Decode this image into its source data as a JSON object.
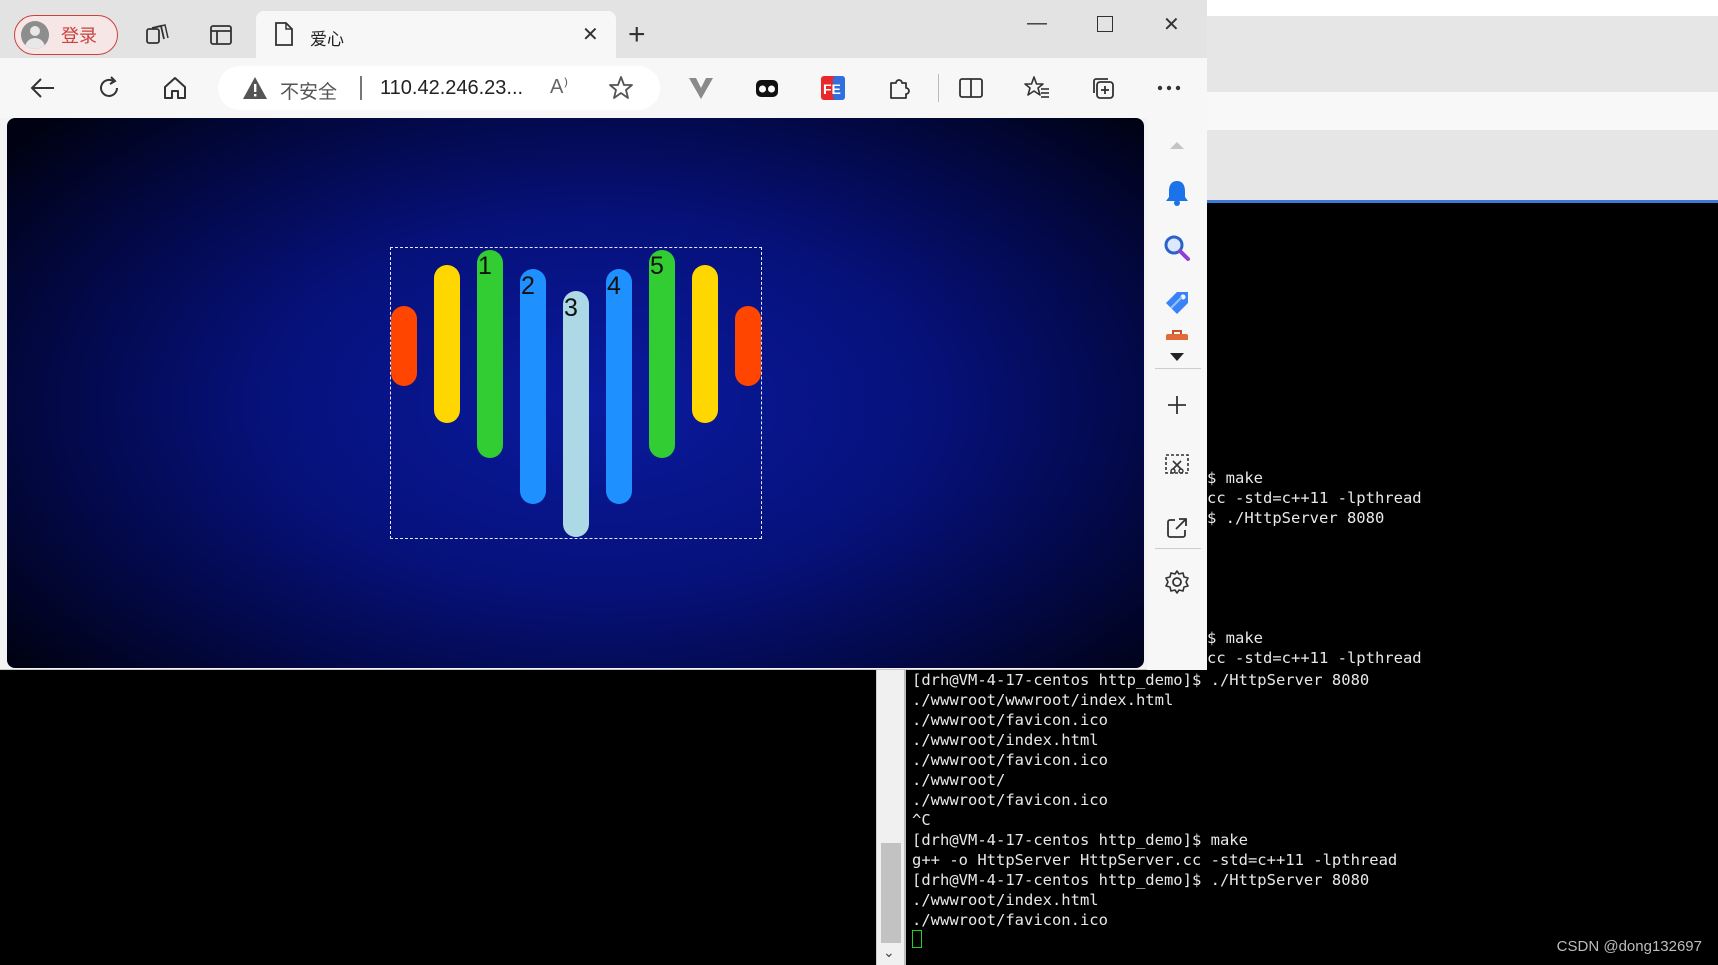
{
  "browser": {
    "login_label": "登录",
    "tab_title": "爱心",
    "address": {
      "security_label": "不安全",
      "url": "110.42.246.23..."
    },
    "read_aloud": "A⁾"
  },
  "sidebar": {
    "icons": [
      "bell-icon",
      "search-icon",
      "tag-icon",
      "briefcase-icon",
      "chevron-down-icon",
      "plus-icon",
      "screenshot-icon",
      "open-external-icon",
      "settings-icon"
    ]
  },
  "page": {
    "bars": [
      {
        "label": "",
        "color": "#ff4500"
      },
      {
        "label": "",
        "color": "#ffd700"
      },
      {
        "label": "1",
        "color": "#32cd32"
      },
      {
        "label": "2",
        "color": "#1e90ff"
      },
      {
        "label": "3",
        "color": "#add8e6"
      },
      {
        "label": "4",
        "color": "#1e90ff"
      },
      {
        "label": "5",
        "color": "#32cd32"
      },
      {
        "label": "",
        "color": "#ffd700"
      },
      {
        "label": "",
        "color": "#ff4500"
      }
    ]
  },
  "terminal": {
    "peek_lines": [
      "$ make",
      "cc -std=c++11 -lpthread",
      "$ ./HttpServer 8080",
      "",
      "",
      "",
      "",
      "",
      "$ make",
      "cc -std=c++11 -lpthread"
    ],
    "lines": [
      "[drh@VM-4-17-centos http_demo]$ ./HttpServer 8080",
      "./wwwroot/wwwroot/index.html",
      "./wwwroot/favicon.ico",
      "./wwwroot/index.html",
      "./wwwroot/favicon.ico",
      "./wwwroot/",
      "./wwwroot/favicon.ico",
      "^C",
      "[drh@VM-4-17-centos http_demo]$ make",
      "g++ -o HttpServer HttpServer.cc -std=c++11 -lpthread",
      "[drh@VM-4-17-centos http_demo]$ ./HttpServer 8080",
      "./wwwroot/index.html",
      "./wwwroot/favicon.ico"
    ]
  },
  "watermark": "CSDN @dong132697"
}
